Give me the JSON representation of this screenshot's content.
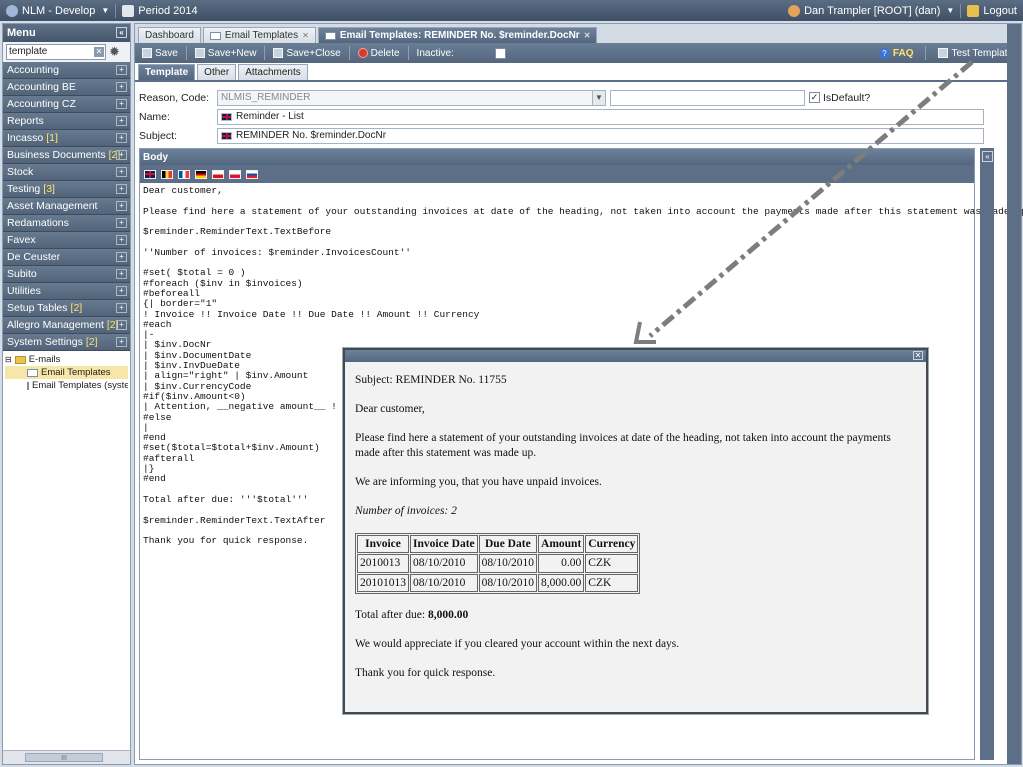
{
  "topbar": {
    "app": "NLM - Develop",
    "period": "Period 2014",
    "user": "Dan Trampler [ROOT] (dan)",
    "logout": "Logout"
  },
  "menu": {
    "title": "Menu",
    "search_value": "template",
    "items": [
      {
        "label": "Accounting",
        "count": ""
      },
      {
        "label": "Accounting BE",
        "count": ""
      },
      {
        "label": "Accounting CZ",
        "count": ""
      },
      {
        "label": "Reports",
        "count": ""
      },
      {
        "label": "Incasso",
        "count": "[1]"
      },
      {
        "label": "Business Documents",
        "count": "[2]"
      },
      {
        "label": "Stock",
        "count": ""
      },
      {
        "label": "Testing",
        "count": "[3]"
      },
      {
        "label": "Asset Management",
        "count": ""
      },
      {
        "label": "Redamations",
        "count": ""
      },
      {
        "label": "Favex",
        "count": ""
      },
      {
        "label": "De Ceuster",
        "count": ""
      },
      {
        "label": "Subito",
        "count": ""
      },
      {
        "label": "Utilities",
        "count": ""
      },
      {
        "label": "Setup Tables",
        "count": "[2]"
      },
      {
        "label": "Allegro Management",
        "count": "[2]"
      },
      {
        "label": "System Settings",
        "count": "[2]"
      }
    ],
    "tree": {
      "folder": "E-mails",
      "children": [
        "Email Templates",
        "Email Templates (system v"
      ]
    },
    "scroll_label": "III"
  },
  "tabs": [
    {
      "label": "Dashboard"
    },
    {
      "label": "Email Templates"
    },
    {
      "label": "Email Templates: REMINDER No. $reminder.DocNr"
    }
  ],
  "toolbar": {
    "save": "Save",
    "save_new": "Save+New",
    "save_close": "Save+Close",
    "delete": "Delete",
    "inactive": "Inactive:",
    "faq": "FAQ",
    "test_template": "Test Template"
  },
  "subtabs": [
    "Template",
    "Other",
    "Attachments"
  ],
  "form": {
    "reason_label": "Reason, Code:",
    "reason_value": "NLMIS_REMINDER",
    "isdefault_label": "IsDefault?",
    "name_label": "Name:",
    "name_value": "Reminder - List",
    "subject_label": "Subject:",
    "subject_value": "REMINDER No. $reminder.DocNr"
  },
  "body": {
    "title": "Body",
    "code": "Dear customer,\n\nPlease find here a statement of your outstanding invoices at date of the heading, not taken into account the payments made after this statement was made up.\n\n$reminder.ReminderText.TextBefore\n\n''Number of invoices: $reminder.InvoicesCount''\n\n#set( $total = 0 )\n#foreach ($inv in $invoices)\n#beforeall\n{| border=\"1\"\n! Invoice !! Invoice Date !! Due Date !! Amount !! Currency\n#each\n|-\n| $inv.DocNr\n| $inv.DocumentDate\n| $inv.InvDueDate\n| align=\"right\" | $inv.Amount\n| $inv.CurrencyCode\n#if($inv.Amount<0)\n| Attention, __negative amount__ !\n#else\n|\n#end\n#set($total=$total+$inv.Amount)\n#afterall\n|}\n#end\n\nTotal after due: '''$total'''\n\n$reminder.ReminderText.TextAfter\n\nThank you for quick response."
  },
  "preview": {
    "subject": "Subject: REMINDER No. 11755",
    "greeting": "Dear customer,",
    "para1": "Please find here a statement of your outstanding invoices at date of the heading, not taken into account the payments made after this statement was made up.",
    "para2": "We are informing you, that you have unpaid invoices.",
    "count_line": "Number of invoices: 2",
    "table_headers": [
      "Invoice",
      "Invoice Date",
      "Due Date",
      "Amount",
      "Currency"
    ],
    "table_rows": [
      [
        "2010013",
        "08/10/2010",
        "08/10/2010",
        "0.00",
        "CZK"
      ],
      [
        "20101013",
        "08/10/2010",
        "08/10/2010",
        "8,000.00",
        "CZK"
      ]
    ],
    "total_label": "Total after due: ",
    "total_value": "8,000.00",
    "para3": "We would appreciate if you cleared your account within the next days.",
    "thanks": "Thank you for quick response."
  }
}
